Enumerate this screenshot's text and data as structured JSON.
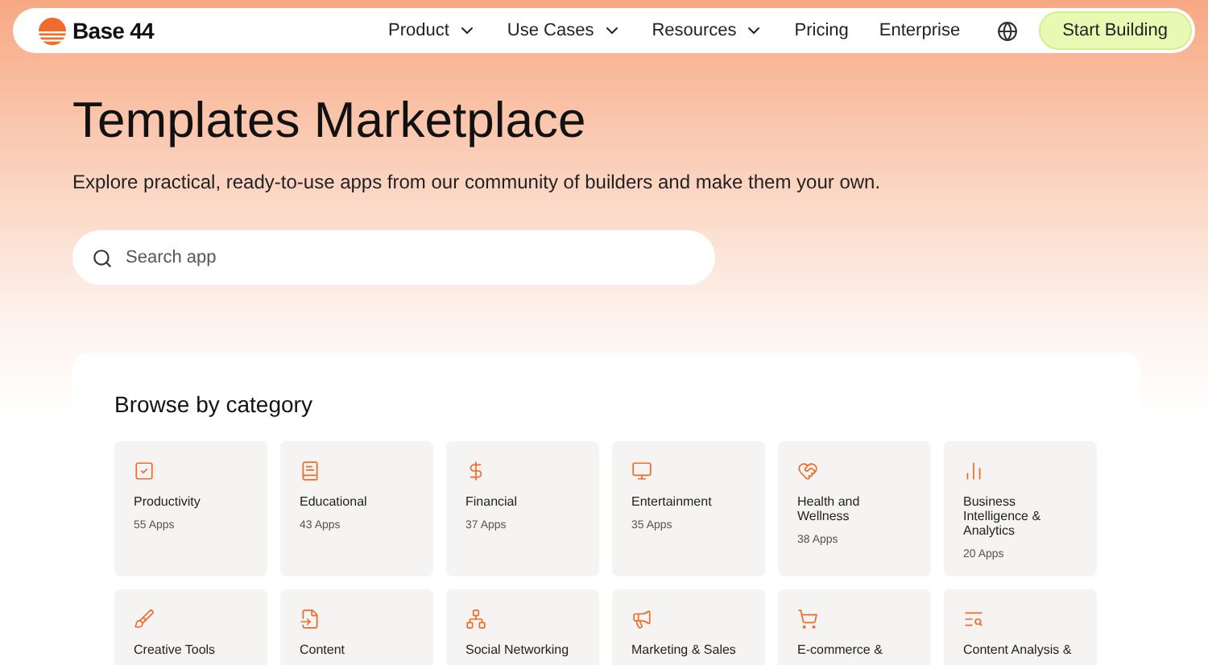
{
  "nav": {
    "brand": "Base 44",
    "menu": [
      {
        "label": "Product",
        "dropdown": true
      },
      {
        "label": "Use Cases",
        "dropdown": true
      },
      {
        "label": "Resources",
        "dropdown": true
      },
      {
        "label": "Pricing",
        "dropdown": false
      },
      {
        "label": "Enterprise",
        "dropdown": false
      }
    ],
    "cta": "Start Building"
  },
  "hero": {
    "title": "Templates Marketplace",
    "subtitle": "Explore practical, ready-to-use apps from our community of builders and make them your own.",
    "search": {
      "placeholder": "Search app"
    }
  },
  "browse": {
    "heading": "Browse by category",
    "categories": [
      {
        "name": "Productivity",
        "count": "55 Apps"
      },
      {
        "name": "Educational",
        "count": "43 Apps"
      },
      {
        "name": "Financial",
        "count": "37 Apps"
      },
      {
        "name": "Entertainment",
        "count": "35 Apps"
      },
      {
        "name": "Health and Wellness",
        "count": "38 Apps"
      },
      {
        "name": "Business Intelligence & Analytics",
        "count": "20 Apps"
      },
      {
        "name": "Creative Tools"
      },
      {
        "name": "Content"
      },
      {
        "name": "Social Networking"
      },
      {
        "name": "Marketing & Sales"
      },
      {
        "name": "E-commerce &"
      },
      {
        "name": "Content Analysis &"
      }
    ]
  }
}
